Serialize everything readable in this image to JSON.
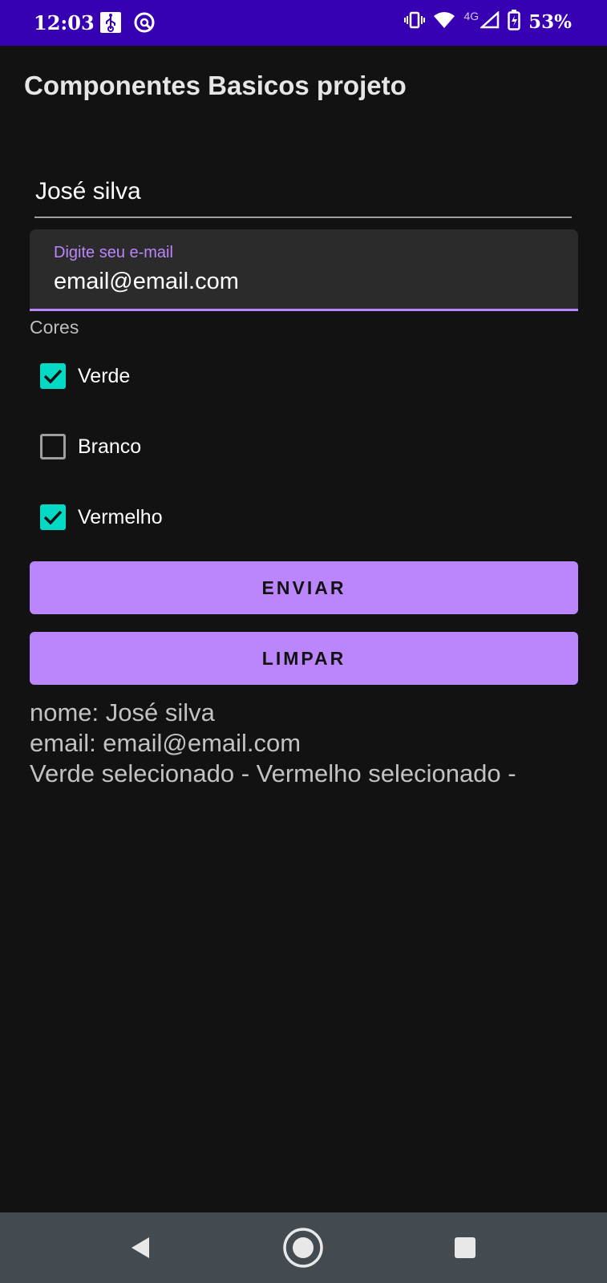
{
  "status_bar": {
    "time": "12:03",
    "network": "4G",
    "battery": "53%"
  },
  "app": {
    "title": "Componentes Basicos projeto"
  },
  "form": {
    "name_value": "José silva",
    "email_label": "Digite seu e-mail",
    "email_value": "email@email.com",
    "colors_label": "Cores",
    "checkboxes": [
      {
        "label": "Verde",
        "checked": true
      },
      {
        "label": "Branco",
        "checked": false
      },
      {
        "label": "Vermelho",
        "checked": true
      }
    ],
    "send_button": "ENVIAR",
    "clear_button": "LIMPAR"
  },
  "result": {
    "line1": "nome: José silva",
    "line2": "email: email@email.com",
    "line3": "Verde selecionado - Vermelho selecionado -"
  },
  "colors": {
    "status_bar": "#3700b3",
    "background": "#121212",
    "accent": "#bb86fc",
    "checkbox_checked": "#03dac5",
    "nav_bar": "#444b50"
  }
}
